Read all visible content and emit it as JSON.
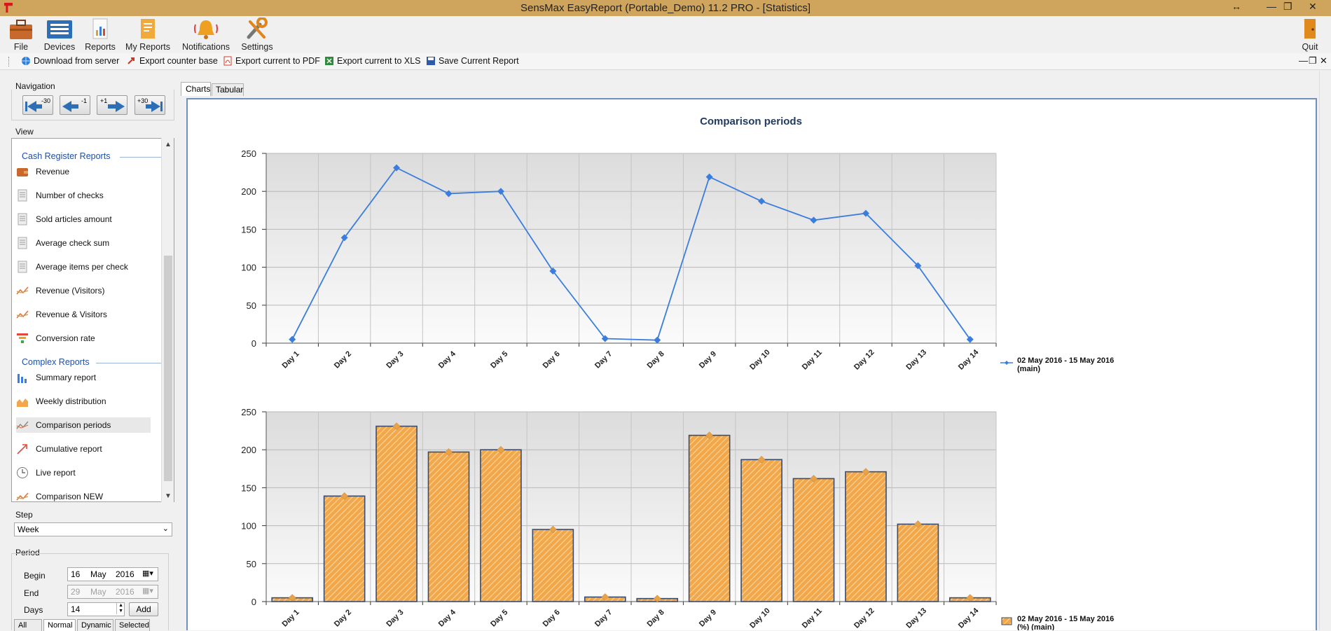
{
  "window": {
    "title": "SensMax EasyReport (Portable_Demo) 11.2 PRO - [Statistics]",
    "controls": [
      "↔",
      "—",
      "❐",
      "✕"
    ]
  },
  "ribbon": {
    "items": [
      {
        "label": "File",
        "icon": "briefcase-icon"
      },
      {
        "label": "Devices",
        "icon": "devices-icon"
      },
      {
        "label": "Reports",
        "icon": "reports-icon"
      },
      {
        "label": "My Reports",
        "icon": "my-reports-icon"
      },
      {
        "label": "Notifications",
        "icon": "bell-icon"
      },
      {
        "label": "Settings",
        "icon": "wrench-icon"
      }
    ],
    "quit_label": "Quit"
  },
  "toolbar": {
    "items": [
      {
        "label": "Download from server",
        "icon": "globe-icon"
      },
      {
        "label": "Export counter base",
        "icon": "export-icon"
      },
      {
        "label": "Export current to PDF",
        "icon": "pdf-icon"
      },
      {
        "label": "Export current to XLS",
        "icon": "xls-icon"
      },
      {
        "label": "Save Current Report",
        "icon": "save-icon"
      }
    ],
    "mdi_controls": [
      "—",
      "❐",
      "✕"
    ]
  },
  "navigation": {
    "label": "Navigation",
    "buttons": [
      {
        "label": "-30",
        "icon": "skip-back-icon"
      },
      {
        "label": "-1",
        "icon": "arrow-left-icon"
      },
      {
        "label": "+1",
        "icon": "arrow-right-icon"
      },
      {
        "label": "+30",
        "icon": "skip-forward-icon"
      }
    ]
  },
  "view": {
    "label": "View",
    "sections": [
      {
        "title": "Cash Register Reports",
        "items": [
          "Revenue",
          "Number of checks",
          "Sold articles amount",
          "Average check sum",
          "Average items per check",
          "Revenue (Visitors)",
          "Revenue & Visitors",
          "Conversion rate"
        ]
      },
      {
        "title": "Complex Reports",
        "items": [
          "Summary report",
          "Weekly distribution",
          "Comparison periods",
          "Cumulative report",
          "Live report",
          "Comparison NEW"
        ]
      }
    ],
    "selected": "Comparison periods"
  },
  "step": {
    "label": "Step",
    "value": "Week"
  },
  "period": {
    "label": "Period",
    "begin_label": "Begin",
    "begin": {
      "day": "16",
      "month": "May",
      "year": "2016"
    },
    "end_label": "End",
    "end": {
      "day": "29",
      "month": "May",
      "year": "2016"
    },
    "days_label": "Days",
    "days": "14",
    "add_label": "Add",
    "tabs": [
      "All",
      "Normal",
      "Dynamic",
      "Selected"
    ]
  },
  "main_tabs": [
    "Charts",
    "Tabular"
  ],
  "colors": {
    "line": "#3b7ddd",
    "bar": "#f2a84a",
    "bar_border": "#3a4d6e",
    "accent": "#1e4fa8"
  },
  "chart_data": [
    {
      "type": "line",
      "title": "Comparison periods",
      "categories": [
        "Day 1",
        "Day 2",
        "Day 3",
        "Day 4",
        "Day 5",
        "Day 6",
        "Day 7",
        "Day 8",
        "Day 9",
        "Day 10",
        "Day 11",
        "Day 12",
        "Day 13",
        "Day 14"
      ],
      "series": [
        {
          "name": "02 May 2016 - 15 May 2016 (main)",
          "values": [
            5,
            139,
            231,
            197,
            200,
            95,
            6,
            4,
            219,
            187,
            162,
            171,
            102,
            5
          ]
        }
      ],
      "ylim": [
        0,
        250
      ],
      "yticks": [
        0,
        50,
        100,
        150,
        200,
        250
      ],
      "grid": true,
      "legend": "right"
    },
    {
      "type": "bar",
      "categories": [
        "Day 1",
        "Day 2",
        "Day 3",
        "Day 4",
        "Day 5",
        "Day 6",
        "Day 7",
        "Day 8",
        "Day 9",
        "Day 10",
        "Day 11",
        "Day 12",
        "Day 13",
        "Day 14"
      ],
      "series": [
        {
          "name": "02 May 2016 - 15 May 2016 (%) (main)",
          "values": [
            5,
            139,
            231,
            197,
            200,
            95,
            6,
            4,
            219,
            187,
            162,
            171,
            102,
            5
          ]
        }
      ],
      "ylim": [
        0,
        250
      ],
      "yticks": [
        0,
        50,
        100,
        150,
        200,
        250
      ],
      "grid": true,
      "legend": "right"
    }
  ]
}
